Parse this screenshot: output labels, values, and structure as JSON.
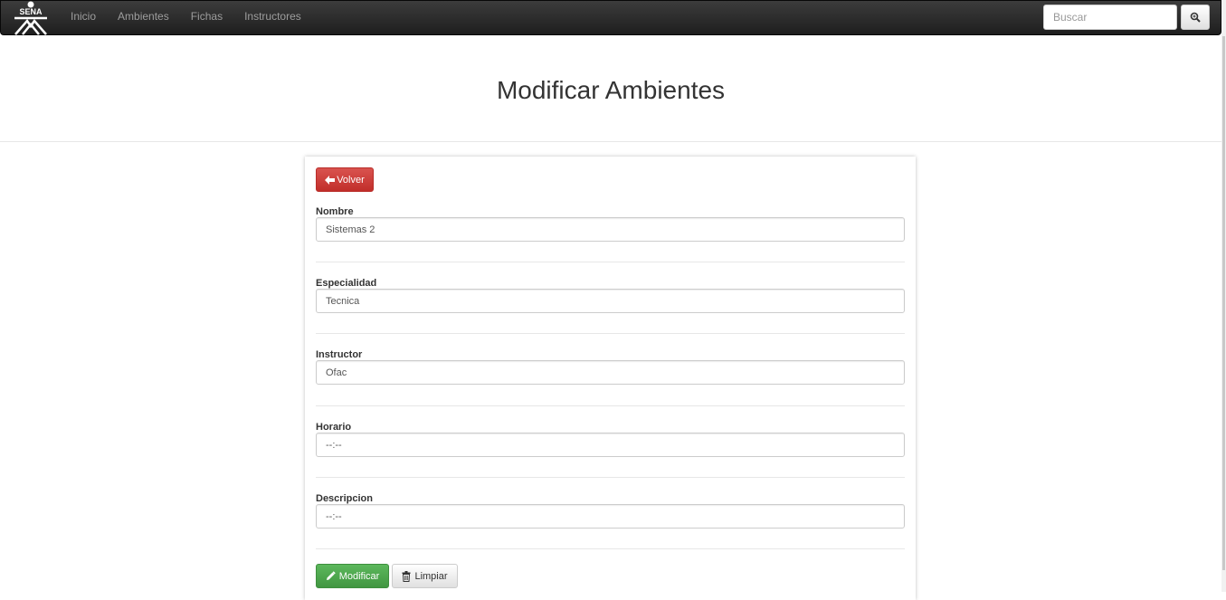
{
  "navbar": {
    "logo_text": "SENA",
    "links": [
      "Inicio",
      "Ambientes",
      "Fichas",
      "Instructores"
    ],
    "search_placeholder": "Buscar"
  },
  "page": {
    "title": "Modificar Ambientes"
  },
  "form": {
    "back_label": "Volver",
    "fields": [
      {
        "label": "Nombre",
        "value": "Sistemas 2"
      },
      {
        "label": "Especialidad",
        "value": "Tecnica"
      },
      {
        "label": "Instructor",
        "value": "Ofac"
      },
      {
        "label": "Horario",
        "value": "--:--"
      },
      {
        "label": "Descripcion",
        "value": "--:--"
      }
    ],
    "modify_label": "Modificar",
    "clear_label": "Limpiar"
  }
}
